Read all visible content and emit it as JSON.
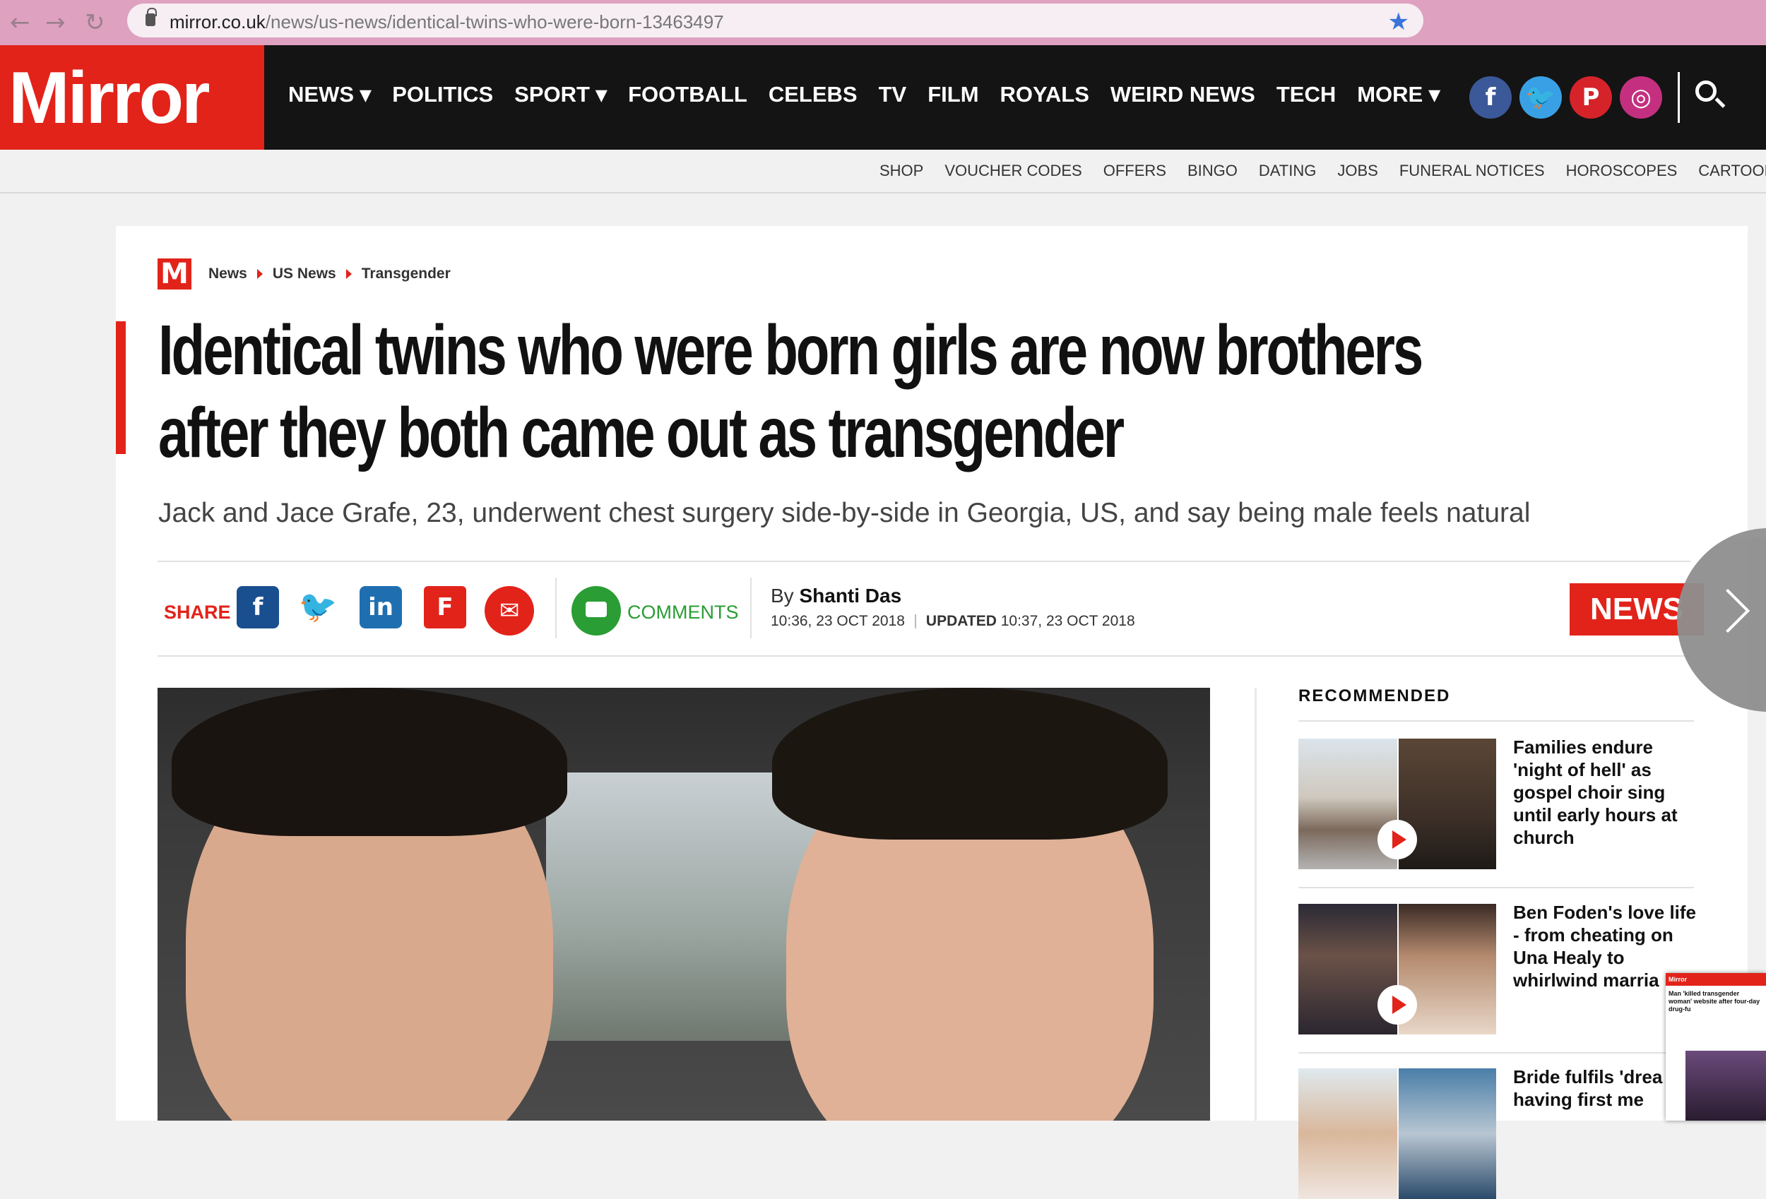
{
  "browser": {
    "url_domain": "mirror.co.uk",
    "url_path": "/news/us-news/identical-twins-who-were-born-13463497",
    "back_icon": "arrow-left-icon",
    "forward_icon": "arrow-right-icon",
    "reload_icon": "reload-icon",
    "bookmark_icon": "star-icon"
  },
  "header": {
    "logo": "Mirror",
    "nav": [
      "NEWS ▾",
      "POLITICS",
      "SPORT ▾",
      "FOOTBALL",
      "CELEBS",
      "TV",
      "FILM",
      "ROYALS",
      "WEIRD NEWS",
      "TECH",
      "MORE ▾"
    ],
    "social": [
      {
        "name": "facebook-icon",
        "glyph": "f",
        "color": "#3b5998"
      },
      {
        "name": "twitter-icon",
        "glyph": "🐦",
        "color": "#3aa0e6"
      },
      {
        "name": "pinterest-icon",
        "glyph": "P",
        "color": "#d6232a"
      },
      {
        "name": "instagram-icon",
        "glyph": "◎",
        "color": "#c4307f"
      }
    ],
    "subnav": [
      "SHOP",
      "VOUCHER CODES",
      "OFFERS",
      "BINGO",
      "DATING",
      "JOBS",
      "FUNERAL NOTICES",
      "HOROSCOPES",
      "CARTOONS"
    ]
  },
  "article": {
    "badge": "M",
    "breadcrumb": [
      "News",
      "US News",
      "Transgender"
    ],
    "headline": "Identical twins who were born girls are now brothers after they both came out as transgender",
    "standfirst": "Jack and Jace Grafe, 23, underwent chest surgery side-by-side in Georgia, US, and say being male feels natural",
    "share_label": "SHARE",
    "comments_label": "COMMENTS",
    "byline_prefix": "By ",
    "author": "Shanti Das",
    "published": "10:36, 23 OCT 2018",
    "updated_label": "UPDATED",
    "updated": "10:37, 23 OCT 2018",
    "section_tag": "NEWS"
  },
  "sidebar": {
    "title": "RECOMMENDED",
    "items": [
      {
        "text": "Families endure 'night of hell' as gospel choir sing until early hours at church",
        "video": true
      },
      {
        "text": "Ben Foden's love life - from cheating on Una Healy to whirlwind marria",
        "video": true
      },
      {
        "text": "Bride fulfils 'drea of having first me",
        "video": false
      }
    ]
  },
  "popup": {
    "brand": "Mirror",
    "headline": "Man 'killed transgender woman' website after four-day drug-fu"
  },
  "colors": {
    "brand_red": "#e2231a",
    "header_black": "#141414",
    "comments_green": "#2a9d34"
  }
}
